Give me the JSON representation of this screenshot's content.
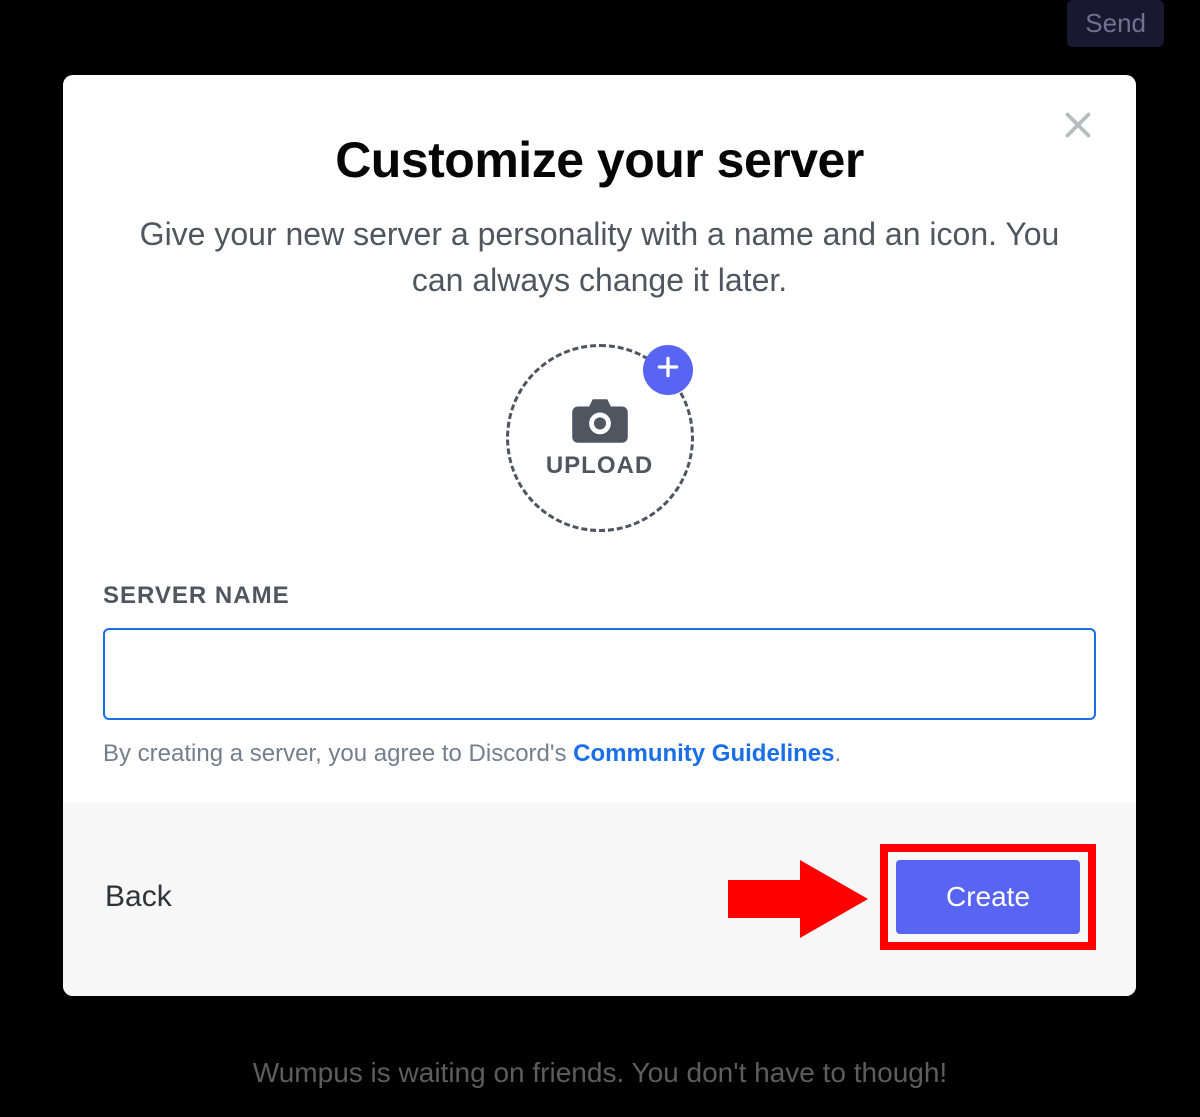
{
  "background": {
    "hint_text": "Wumpus is waiting on friends. You don't have to though!",
    "send_label": "Send"
  },
  "modal": {
    "title": "Customize your server",
    "subtitle": "Give your new server a personality with a name and an icon. You can always change it later.",
    "upload_label": "UPLOAD",
    "server_name_label": "SERVER NAME",
    "server_name_value": "",
    "agree_prefix": "By creating a server, you agree to Discord's ",
    "agree_link": "Community Guidelines",
    "agree_suffix": ".",
    "back_label": "Back",
    "create_label": "Create",
    "colors": {
      "accent": "#5865f2",
      "focus_border": "#1a6fe8",
      "annotation": "#ff0000"
    }
  }
}
